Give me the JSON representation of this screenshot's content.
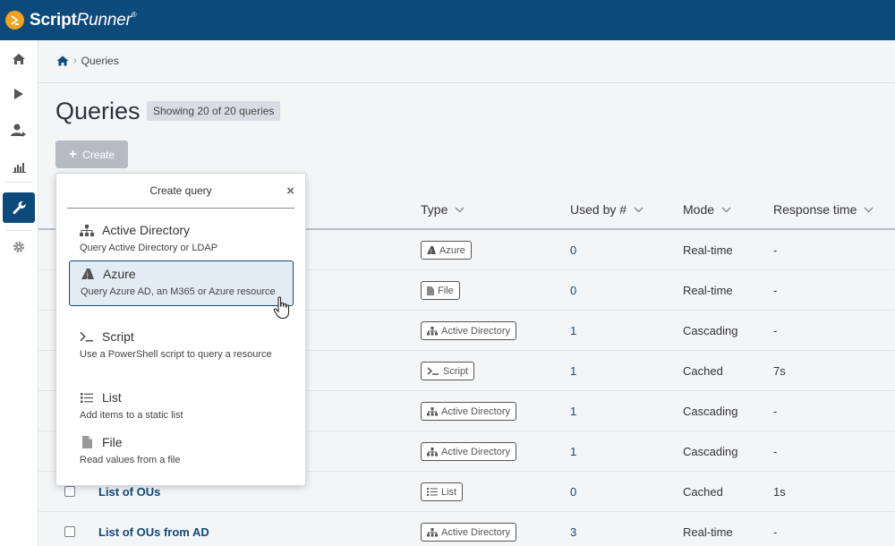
{
  "app": {
    "brand_main": "Script",
    "brand_italic": "Runner",
    "brand_mark": "®"
  },
  "sidebar": {
    "items": [
      {
        "icon": "home-icon"
      },
      {
        "icon": "play-icon"
      },
      {
        "icon": "user-icon"
      },
      {
        "icon": "chart-icon"
      },
      {
        "icon": "wrench-icon",
        "active": true
      },
      {
        "icon": "gear-icon"
      }
    ]
  },
  "breadcrumb": {
    "current": "Queries"
  },
  "page": {
    "title": "Queries",
    "count_label": "Showing 20 of 20 queries",
    "create_label": "Create"
  },
  "table": {
    "columns": [
      "Type",
      "Used by #",
      "Mode",
      "Response time"
    ],
    "rows": [
      {
        "name": "",
        "type": "Azure",
        "type_icon": "azure-icon",
        "used_by": "0",
        "mode": "Real-time",
        "response": "-"
      },
      {
        "name": "",
        "type": "File",
        "type_icon": "file-icon",
        "used_by": "0",
        "mode": "Real-time",
        "response": "-"
      },
      {
        "name": "",
        "type": "Active Directory",
        "type_icon": "sitemap-icon",
        "used_by": "1",
        "mode": "Cascading",
        "response": "-"
      },
      {
        "name": "",
        "type": "Script",
        "type_icon": "terminal-icon",
        "used_by": "1",
        "mode": "Cached",
        "response": "7s"
      },
      {
        "name": "",
        "type": "Active Directory",
        "type_icon": "sitemap-icon",
        "used_by": "1",
        "mode": "Cascading",
        "response": "-"
      },
      {
        "name": "",
        "type": "Active Directory",
        "type_icon": "sitemap-icon",
        "used_by": "1",
        "mode": "Cascading",
        "response": "-"
      },
      {
        "name": "List of OUs",
        "type": "List",
        "type_icon": "list-icon",
        "used_by": "0",
        "mode": "Cached",
        "response": "1s"
      },
      {
        "name": "List of OUs from AD",
        "type": "Active Directory",
        "type_icon": "sitemap-icon",
        "used_by": "3",
        "mode": "Real-time",
        "response": "-"
      }
    ]
  },
  "create_menu": {
    "title": "Create query",
    "close": "×",
    "items": [
      {
        "title": "Active Directory",
        "desc": "Query Active Directory or LDAP",
        "icon": "sitemap-icon"
      },
      {
        "title": "Azure",
        "desc": "Query Azure AD, an M365 or Azure resource",
        "icon": "azure-icon",
        "selected": true
      },
      {
        "title": "Script",
        "desc": "Use a PowerShell script to query a resource",
        "icon": "terminal-icon"
      },
      {
        "title": "List",
        "desc": "Add items to a static list",
        "icon": "list-icon"
      },
      {
        "title": "File",
        "desc": "Read values from a file",
        "icon": "file-icon"
      }
    ]
  },
  "colors": {
    "brand": "#0d4a7c",
    "accent": "#f4a11d"
  }
}
